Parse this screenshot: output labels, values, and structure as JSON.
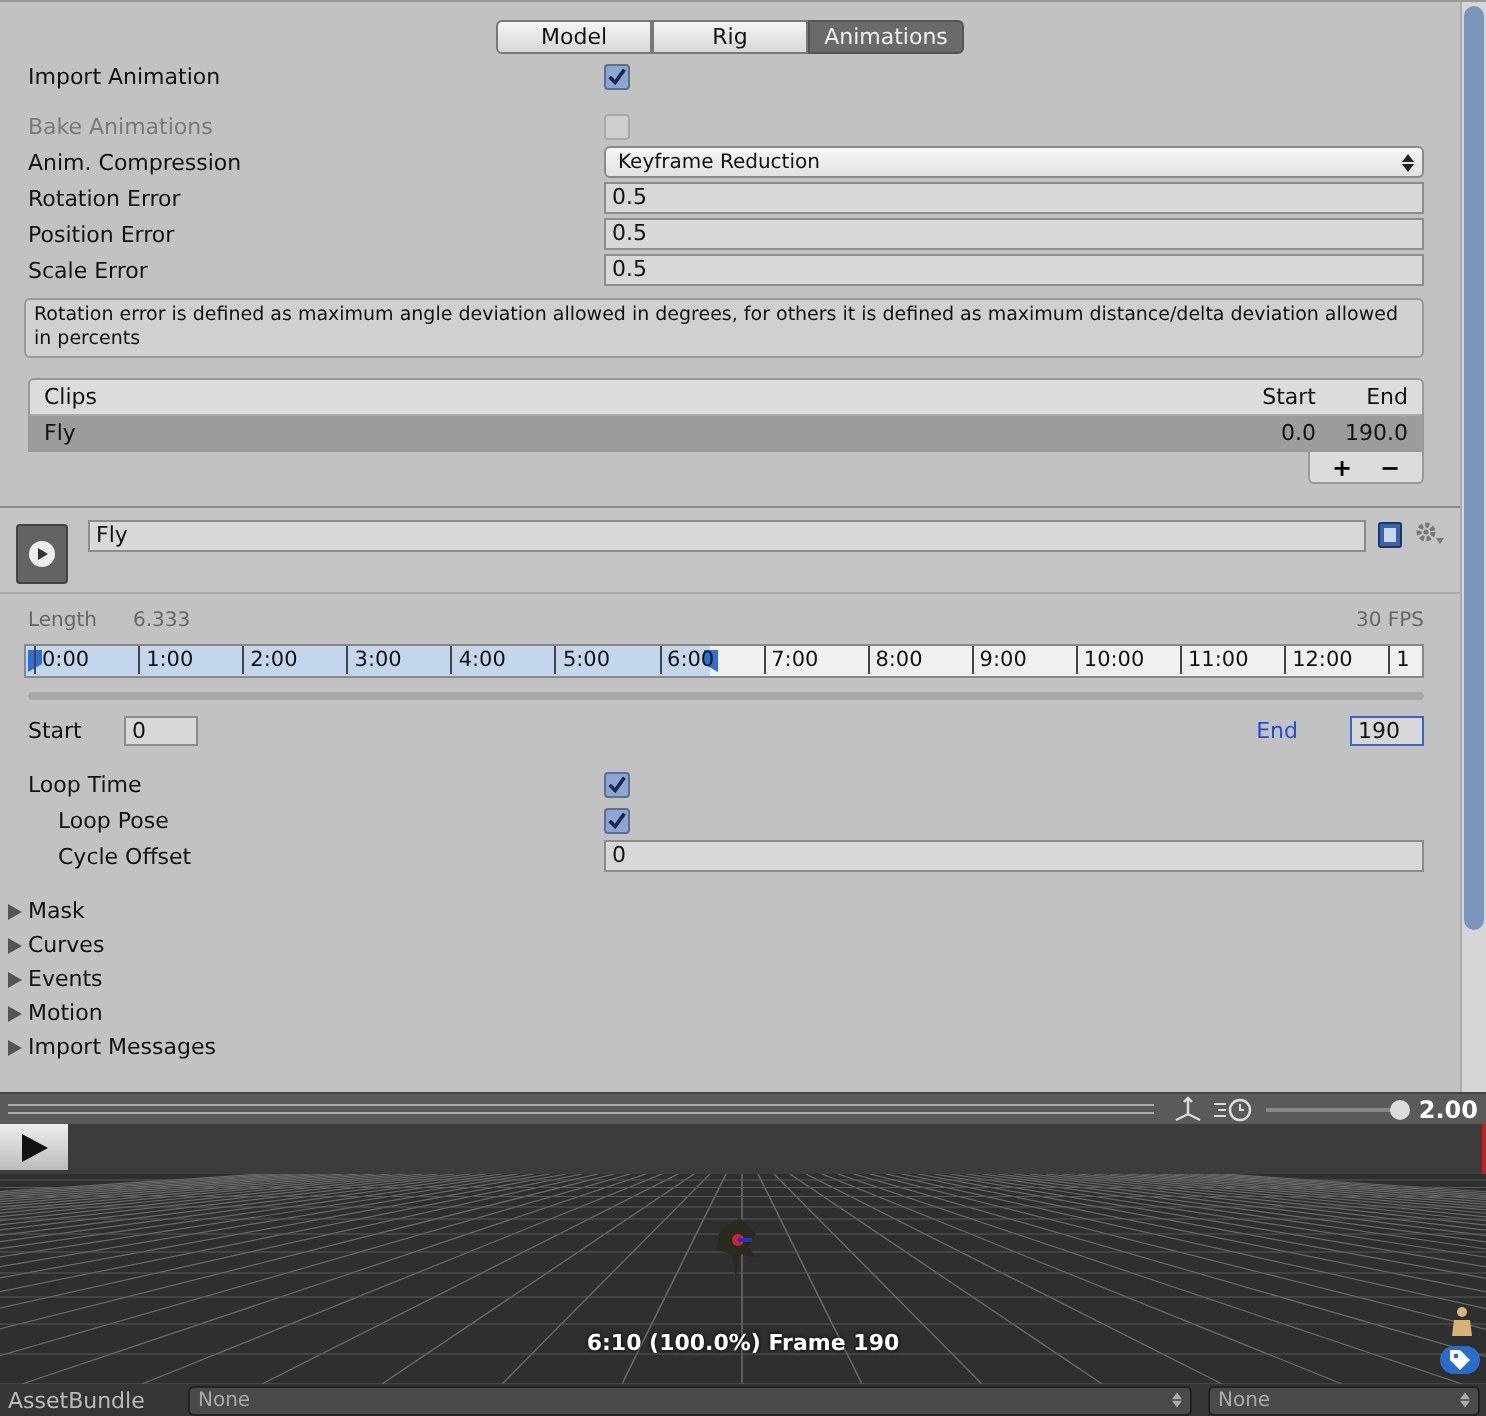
{
  "tabs": [
    {
      "label": "Model",
      "selected": false
    },
    {
      "label": "Rig",
      "selected": false
    },
    {
      "label": "Animations",
      "selected": true
    }
  ],
  "settings": [
    {
      "kind": "checkbox",
      "label": "Import Animation",
      "checked": true,
      "disabled": false
    },
    {
      "kind": "checkbox",
      "label": "Bake Animations",
      "checked": false,
      "disabled": true
    },
    {
      "kind": "dropdown",
      "label": "Anim. Compression",
      "value": "Keyframe Reduction"
    },
    {
      "kind": "field",
      "label": "Rotation Error",
      "value": "0.5"
    },
    {
      "kind": "field",
      "label": "Position Error",
      "value": "0.5"
    },
    {
      "kind": "field",
      "label": "Scale Error",
      "value": "0.5"
    }
  ],
  "help_text": "Rotation error is defined as maximum angle deviation allowed in degrees, for others it is defined as maximum distance/delta deviation allowed in percents",
  "clips": {
    "columns": [
      "Clips",
      "Start",
      "End"
    ],
    "rows": [
      {
        "name": "Fly",
        "start": "0.0",
        "end": "190.0",
        "selected": true
      }
    ],
    "buttons": [
      "+",
      "−"
    ]
  },
  "clip": {
    "name": "Fly"
  },
  "length": {
    "label": "Length",
    "value": "6.333",
    "fps": "30 FPS"
  },
  "timeline": {
    "ticks": [
      "0:00",
      "1:00",
      "2:00",
      "3:00",
      "4:00",
      "5:00",
      "6:00",
      "7:00",
      "8:00",
      "9:00",
      "10:00",
      "11:00",
      "12:00",
      "1"
    ],
    "level": 0.49
  },
  "range": {
    "start_label": "Start",
    "start_value": "0",
    "end_label": "End",
    "end_value": "190"
  },
  "loop": [
    {
      "kind": "checkbox",
      "label": "Loop Time",
      "checked": true,
      "children": [
        {
          "kind": "checkbox",
          "label": "Loop Pose",
          "checked": true
        },
        {
          "kind": "field",
          "label": "Cycle Offset",
          "value": "0"
        }
      ]
    }
  ],
  "foldouts": [
    {
      "label": "Mask",
      "expanded": false
    },
    {
      "label": "Curves",
      "expanded": false
    },
    {
      "label": "Events",
      "expanded": false
    },
    {
      "label": "Motion",
      "expanded": false
    },
    {
      "label": "Import Messages",
      "expanded": false
    }
  ],
  "preview_toolbar": {
    "speed": "2.00",
    "level": 0.95
  },
  "preview": {
    "caption": "6:10 (100.0%) Frame 190"
  },
  "asset_bundle": {
    "label": "AssetBundle",
    "values": [
      "None",
      "None"
    ]
  }
}
